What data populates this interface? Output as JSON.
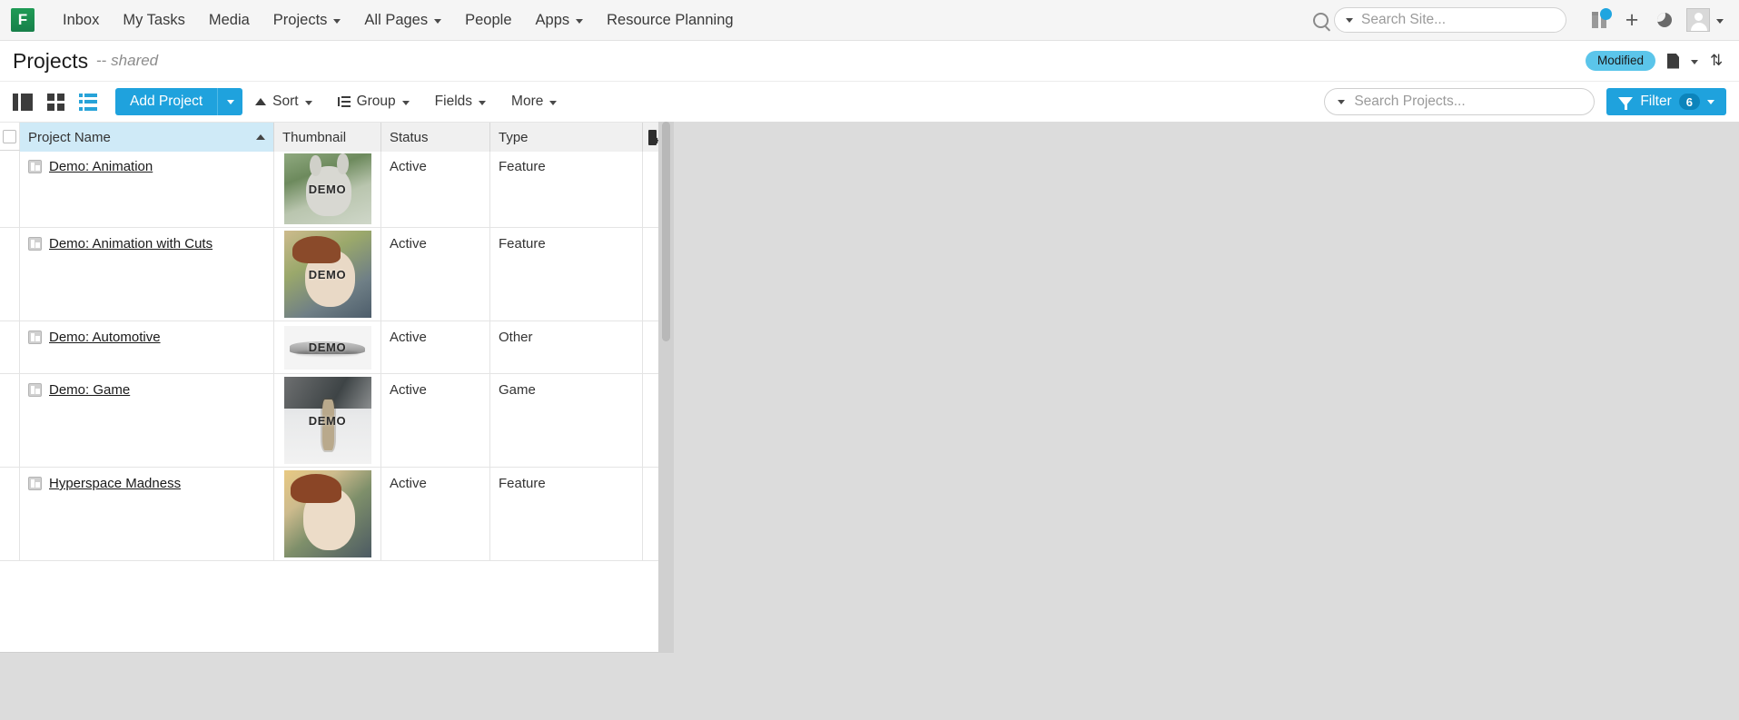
{
  "topnav": {
    "logo_text": "F",
    "items": [
      {
        "label": "Inbox",
        "has_caret": false
      },
      {
        "label": "My Tasks",
        "has_caret": false
      },
      {
        "label": "Media",
        "has_caret": false
      },
      {
        "label": "Projects",
        "has_caret": true
      },
      {
        "label": "All Pages",
        "has_caret": true
      },
      {
        "label": "People",
        "has_caret": false
      },
      {
        "label": "Apps",
        "has_caret": true
      },
      {
        "label": "Resource Planning",
        "has_caret": false
      }
    ],
    "search": {
      "placeholder": "Search Site...",
      "icon": "search-icon"
    },
    "icons": [
      "gift-icon",
      "plus-icon",
      "moon-icon",
      "avatar-icon",
      "chevron-down-icon"
    ],
    "notification_badge": ""
  },
  "page": {
    "title": "Projects",
    "subtitle_dashes": "--",
    "subtitle": "shared",
    "status_badge": "Modified",
    "doc_icon": "document-icon",
    "sync_icon": "refresh-icon"
  },
  "toolbar": {
    "views": [
      "split-view-icon",
      "grid-view-icon",
      "list-view-icon"
    ],
    "active_view": "list-view-icon",
    "add_project_label": "Add Project",
    "sort_label": "Sort",
    "group_label": "Group",
    "fields_label": "Fields",
    "more_label": "More",
    "search_placeholder": "Search Projects...",
    "search_value": "",
    "filter_label": "Filter",
    "filter_count": "6"
  },
  "colors": {
    "accent": "#1fa2dd",
    "badge": "#5bc5ea",
    "sorted_header": "#cfeaf7",
    "logo_green": "#17804a"
  },
  "table": {
    "columns": [
      "Project Name",
      "Thumbnail",
      "Status",
      "Type"
    ],
    "sorted_column": "Project Name",
    "sort_direction": "asc",
    "add_column_icon": "add-column-icon",
    "rows": [
      {
        "name": "Demo: Animation",
        "thumb_label": "DEMO",
        "thumb_art": "t-bunny",
        "status": "Active",
        "type": "Feature"
      },
      {
        "name": "Demo: Animation with Cuts",
        "thumb_label": "DEMO",
        "thumb_art": "t-boy",
        "status": "Active",
        "type": "Feature"
      },
      {
        "name": "Demo: Automotive",
        "thumb_label": "DEMO",
        "thumb_art": "t-car",
        "status": "Active",
        "type": "Other"
      },
      {
        "name": "Demo: Game",
        "thumb_label": "DEMO",
        "thumb_art": "t-game",
        "status": "Active",
        "type": "Game"
      },
      {
        "name": "Hyperspace Madness",
        "thumb_label": "",
        "thumb_art": "t-hyper",
        "status": "Active",
        "type": "Feature"
      }
    ]
  }
}
